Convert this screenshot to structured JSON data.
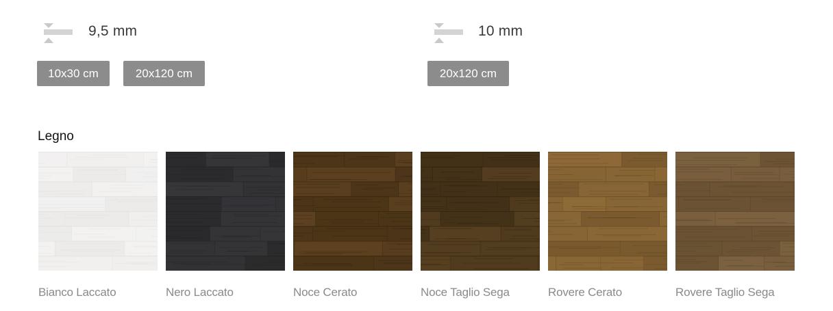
{
  "thickness_left": {
    "icon": "thickness-icon",
    "value": "9,5 mm",
    "sizes": [
      "10x30 cm",
      "20x120 cm"
    ]
  },
  "thickness_right": {
    "icon": "thickness-icon",
    "value": "10 mm",
    "sizes": [
      "20x120 cm"
    ]
  },
  "section": {
    "title": "Legno"
  },
  "swatches": [
    {
      "name": "Bianco Laccato",
      "base": "#ecebea",
      "plank": "#f3f2f1",
      "dark": "#dcdad8"
    },
    {
      "name": "Nero Laccato",
      "base": "#2b2b2d",
      "plank": "#37373a",
      "dark": "#1d1d1f"
    },
    {
      "name": "Noce Cerato",
      "base": "#4c3518",
      "plank": "#5e4220",
      "dark": "#2e1d0b"
    },
    {
      "name": "Noce Taglio Sega",
      "base": "#433118",
      "plank": "#574021",
      "dark": "#2a1c0b"
    },
    {
      "name": "Rovere Cerato",
      "base": "#7a5a2e",
      "plank": "#8e6a38",
      "dark": "#5a3f1c"
    },
    {
      "name": "Rovere Taglio Sega",
      "base": "#6b5334",
      "plank": "#7c6240",
      "dark": "#4d3b22"
    }
  ]
}
